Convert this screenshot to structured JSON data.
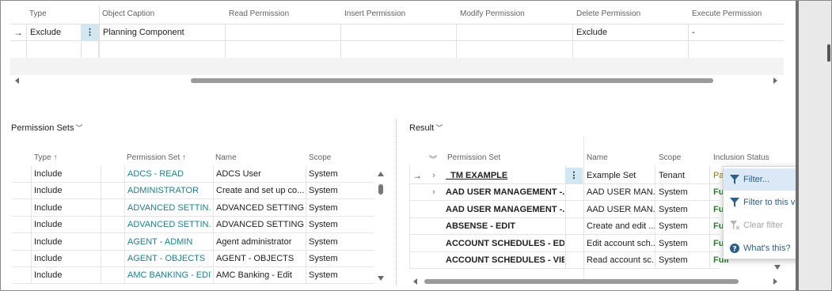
{
  "top_grid": {
    "headers": {
      "type": "Type",
      "object_caption": "Object Caption",
      "read": "Read Permission",
      "insert": "Insert Permission",
      "modify": "Modify Permission",
      "delete": "Delete Permission",
      "execute": "Execute Permission"
    },
    "row": {
      "arrow": "→",
      "type": "Exclude",
      "dots": "⋮",
      "object_caption": "Planning Component",
      "delete": "Exclude",
      "execute": "-"
    }
  },
  "permission_sets": {
    "title": "Permission Sets",
    "chevron": "﹀",
    "headers": {
      "type": "Type ↑",
      "permission_set": "Permission Set ↑",
      "name": "Name",
      "scope": "Scope"
    },
    "rows": [
      {
        "type": "Include",
        "permission_set": "ADCS - READ",
        "name": "ADCS User",
        "scope": "System"
      },
      {
        "type": "Include",
        "permission_set": "ADMINISTRATOR",
        "name": "Create and set up co...",
        "scope": "System"
      },
      {
        "type": "Include",
        "permission_set": "ADVANCED SETTIN...",
        "name": "ADVANCED SETTING...",
        "scope": "System"
      },
      {
        "type": "Include",
        "permission_set": "ADVANCED SETTIN...",
        "name": "ADVANCED SETTING...",
        "scope": "System"
      },
      {
        "type": "Include",
        "permission_set": "AGENT - ADMIN",
        "name": "Agent administrator",
        "scope": "System"
      },
      {
        "type": "Include",
        "permission_set": "AGENT - OBJECTS",
        "name": "AGENT - OBJECTS",
        "scope": "System"
      },
      {
        "type": "Include",
        "permission_set": "AMC BANKING - EDIT",
        "name": "AMC Banking - Edit",
        "scope": "System"
      }
    ]
  },
  "result": {
    "title": "Result",
    "chevron": "﹀",
    "collapse_glyph": "︾",
    "headers": {
      "permission_set": "Permission Set",
      "name": "Name",
      "scope": "Scope",
      "inclusion_status": "Inclusion Status"
    },
    "rows": [
      {
        "arrow": "→",
        "expander": "›",
        "permission_set": "_TM EXAMPLE",
        "dots": "⋮",
        "name": "Example Set",
        "scope": "Tenant",
        "status": "Pa"
      },
      {
        "arrow": "",
        "expander": "›",
        "permission_set": "AAD USER MANAGEMENT -...",
        "dots": "",
        "name": "AAD USER MAN...",
        "scope": "System",
        "status": "Fu"
      },
      {
        "arrow": "",
        "expander": "",
        "permission_set": "AAD USER MANAGEMENT -...",
        "dots": "",
        "name": "AAD USER MAN...",
        "scope": "System",
        "status": "Fu"
      },
      {
        "arrow": "",
        "expander": "",
        "permission_set": "ABSENSE - EDIT",
        "dots": "",
        "name": "Create and edit ...",
        "scope": "System",
        "status": "Fu"
      },
      {
        "arrow": "",
        "expander": "",
        "permission_set": "ACCOUNT SCHEDULES - EDIT",
        "dots": "",
        "name": "Edit account sch...",
        "scope": "System",
        "status": "Fu"
      },
      {
        "arrow": "",
        "expander": "",
        "permission_set": "ACCOUNT SCHEDULES - VIE...",
        "dots": "",
        "name": "Read account sc...",
        "scope": "System",
        "status": "Full"
      }
    ]
  },
  "context_menu": {
    "items": [
      {
        "label": "Filter...",
        "icon": "filter-icon"
      },
      {
        "label": "Filter to this value",
        "icon": "filter-icon"
      },
      {
        "label": "Clear filter",
        "icon": "clear-filter-icon"
      },
      {
        "label": "What's this?",
        "icon": "help-icon"
      }
    ]
  }
}
